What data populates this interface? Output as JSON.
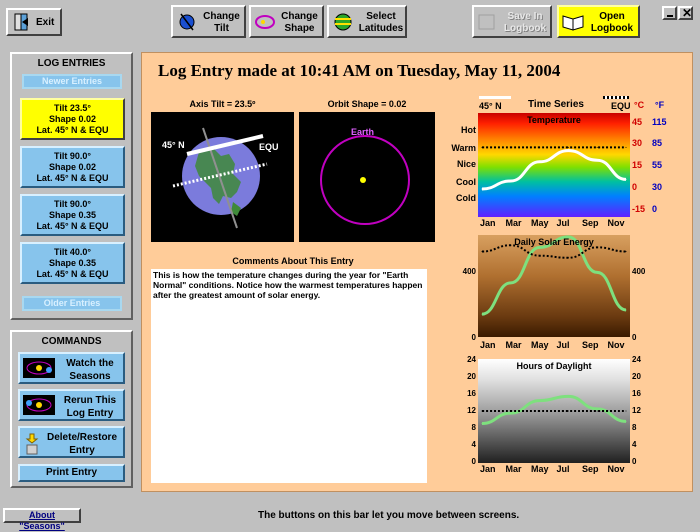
{
  "toolbar": {
    "exit": "Exit",
    "change_tilt": [
      "Change",
      "Tilt"
    ],
    "change_shape": [
      "Change",
      "Shape"
    ],
    "select_latitudes": [
      "Select",
      "Latitudes"
    ],
    "save_logbook": [
      "Save In",
      "Logbook"
    ],
    "open_logbook": [
      "Open",
      "Logbook"
    ]
  },
  "log_entries": {
    "title": "LOG ENTRIES",
    "newer": "Newer Entries",
    "older": "Older Entries",
    "items": [
      {
        "l1": "Tilt 23.5°",
        "l2": "Shape 0.02",
        "l3": "Lat. 45° N & EQU",
        "selected": true
      },
      {
        "l1": "Tilt 90.0°",
        "l2": "Shape 0.02",
        "l3": "Lat. 45° N & EQU",
        "selected": false
      },
      {
        "l1": "Tilt 90.0°",
        "l2": "Shape 0.35",
        "l3": "Lat. 45° N & EQU",
        "selected": false
      },
      {
        "l1": "Tilt 40.0°",
        "l2": "Shape 0.35",
        "l3": "Lat. 45° N & EQU",
        "selected": false
      }
    ]
  },
  "commands": {
    "title": "COMMANDS",
    "watch": [
      "Watch the",
      "Seasons"
    ],
    "rerun": [
      "Rerun This",
      "Log Entry"
    ],
    "delete": [
      "Delete/Restore",
      "Entry"
    ],
    "print": "Print Entry"
  },
  "main": {
    "heading": "Log Entry made at 10:41 AM on Tuesday, May 11, 2004",
    "axis_tilt_label": "Axis Tilt = 23.5º",
    "orbit_shape_label": "Orbit Shape = 0.02",
    "globe_lat_label": "45° N",
    "globe_equ_label": "EQU",
    "orbit_earth_label": "Earth",
    "comments_title": "Comments About This Entry",
    "comments_text": "This is how the temperature changes during the year for \"Earth Normal\" conditions.  Notice how the warmest temperatures happen after the greatest amount of solar energy."
  },
  "time_series": {
    "title": "Time Series",
    "legend_left": "45° N",
    "legend_right": "EQU",
    "unit_c": "°C",
    "unit_f": "°F",
    "temperature_title": "Temperature",
    "solar_title": "Daily Solar Energy",
    "daylight_title": "Hours of Daylight",
    "temp_words": [
      "Hot",
      "Warm",
      "Nice",
      "Cool",
      "Cold"
    ],
    "temp_c_ticks": [
      "45",
      "30",
      "15",
      "0",
      "-15"
    ],
    "temp_f_ticks": [
      "115",
      "85",
      "55",
      "30",
      "0"
    ],
    "solar_ticks": [
      "400",
      "0"
    ],
    "daylight_ticks": [
      "24",
      "20",
      "16",
      "12",
      "8",
      "4",
      "0"
    ],
    "months": [
      "Jan",
      "Mar",
      "May",
      "Jul",
      "Sep",
      "Nov"
    ],
    "colors": {
      "lat45": "#ffffff",
      "equ": "#000000",
      "solar_curve": "#7ee07e",
      "daylight_curve": "#7ee07e"
    }
  },
  "status_bar": {
    "about": "About \"Seasons\"",
    "message": "The buttons on this bar let you move between screens."
  },
  "chart_data": [
    {
      "type": "line",
      "title": "Temperature",
      "x": [
        "Jan",
        "Mar",
        "May",
        "Jul",
        "Sep",
        "Nov"
      ],
      "ylabel": "°C",
      "ylim": [
        -15,
        45
      ],
      "series": [
        {
          "name": "45° N",
          "values": [
            0,
            5,
            17,
            24,
            18,
            6
          ]
        },
        {
          "name": "EQU",
          "values": [
            26,
            26,
            26,
            26,
            26,
            26
          ]
        }
      ]
    },
    {
      "type": "line",
      "title": "Daily Solar Energy",
      "x": [
        "Jan",
        "Mar",
        "May",
        "Jul",
        "Sep",
        "Nov"
      ],
      "ylim": [
        0,
        460
      ],
      "series": [
        {
          "name": "45° N",
          "values": [
            100,
            250,
            420,
            470,
            300,
            120
          ]
        },
        {
          "name": "EQU",
          "values": [
            400,
            430,
            380,
            370,
            420,
            400
          ]
        }
      ]
    },
    {
      "type": "line",
      "title": "Hours of Daylight",
      "x": [
        "Jan",
        "Mar",
        "May",
        "Jul",
        "Sep",
        "Nov"
      ],
      "ylim": [
        0,
        24
      ],
      "series": [
        {
          "name": "45° N",
          "values": [
            9,
            11.5,
            14.5,
            15.5,
            12.5,
            9.5
          ]
        },
        {
          "name": "EQU",
          "values": [
            12,
            12,
            12,
            12,
            12,
            12
          ]
        }
      ]
    }
  ]
}
